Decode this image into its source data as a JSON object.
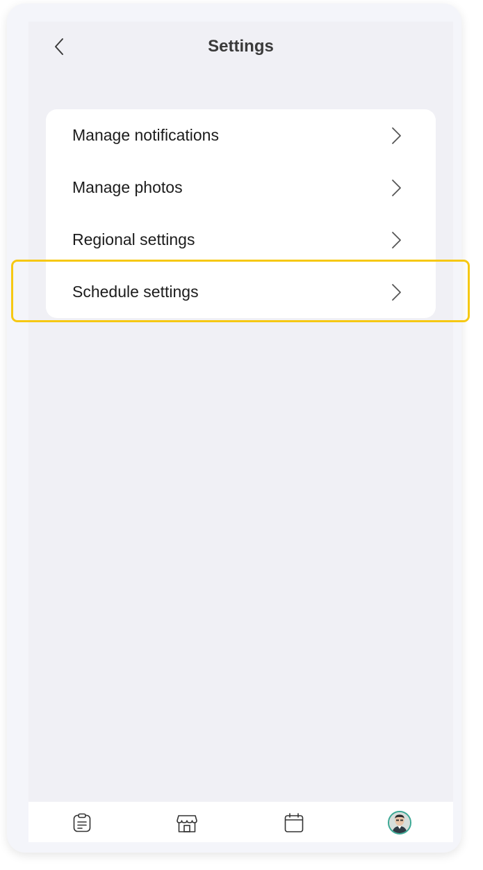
{
  "header": {
    "title": "Settings",
    "back_icon": "chevron-left-icon"
  },
  "settings": {
    "items": [
      {
        "label": "Manage notifications",
        "icon": "chevron-right-icon"
      },
      {
        "label": "Manage photos",
        "icon": "chevron-right-icon"
      },
      {
        "label": "Regional settings",
        "icon": "chevron-right-icon"
      },
      {
        "label": "Schedule settings",
        "icon": "chevron-right-icon",
        "highlighted": true
      }
    ]
  },
  "tabbar": {
    "tabs": [
      {
        "icon": "clipboard-icon"
      },
      {
        "icon": "store-icon"
      },
      {
        "icon": "calendar-icon"
      },
      {
        "icon": "avatar"
      }
    ]
  },
  "colors": {
    "highlight": "#f6c813",
    "background": "#f0f0f5",
    "card": "#ffffff",
    "avatar_ring": "#3aa894"
  }
}
